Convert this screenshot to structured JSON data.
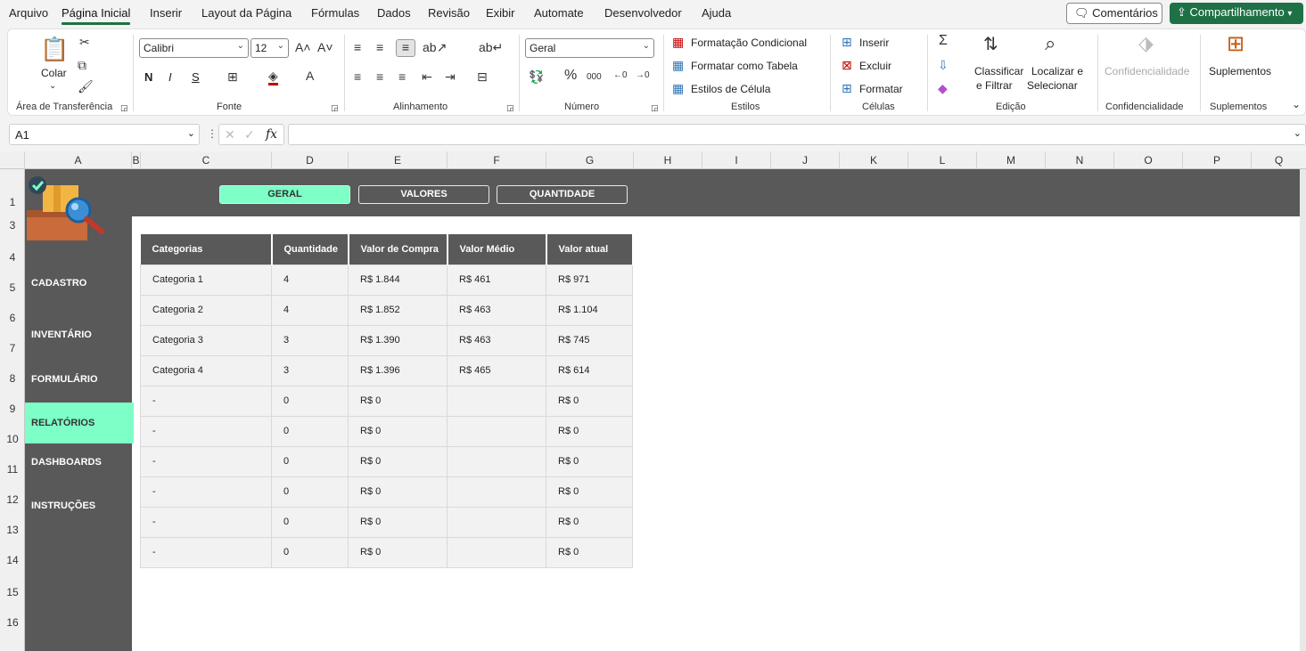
{
  "menu": {
    "items": [
      "Arquivo",
      "Página Inicial",
      "Inserir",
      "Layout da Página",
      "Fórmulas",
      "Dados",
      "Revisão",
      "Exibir",
      "Automate",
      "Desenvolvedor",
      "Ajuda"
    ],
    "comments": "Comentários",
    "share": "Compartilhamento"
  },
  "ribbon": {
    "clipboard": {
      "paste": "Colar",
      "label": "Área de Transferência"
    },
    "font": {
      "name": "Calibri",
      "size": "12",
      "bold": "N",
      "italic": "I",
      "underline": "S",
      "label": "Fonte"
    },
    "alignment": {
      "label": "Alinhamento"
    },
    "number": {
      "format": "Geral",
      "label": "Número"
    },
    "styles": {
      "conditional": "Formatação Condicional",
      "as_table": "Formatar como Tabela",
      "cell_styles": "Estilos de Célula",
      "label": "Estilos"
    },
    "cells": {
      "insert": "Inserir",
      "delete": "Excluir",
      "format": "Formatar",
      "label": "Células"
    },
    "editing": {
      "sort1": "Classificar",
      "sort2": "e Filtrar",
      "find1": "Localizar e",
      "find2": "Selecionar",
      "label": "Edição"
    },
    "sensitivity": {
      "button": "Confidencialidade",
      "label": "Confidencialidade"
    },
    "addins": {
      "button": "Suplementos",
      "label": "Suplementos"
    }
  },
  "formula_bar": {
    "name_box": "A1",
    "fx": "fx",
    "value": ""
  },
  "columns": [
    "A",
    "B",
    "C",
    "D",
    "E",
    "F",
    "G",
    "H",
    "I",
    "J",
    "K",
    "L",
    "M",
    "N",
    "O",
    "P",
    "Q"
  ],
  "rows": [
    "1",
    "3",
    "4",
    "5",
    "6",
    "7",
    "8",
    "9",
    "10",
    "11",
    "12",
    "13",
    "14",
    "15",
    "16"
  ],
  "dashboard": {
    "tabs": [
      {
        "label": "GERAL",
        "active": true
      },
      {
        "label": "VALORES",
        "active": false
      },
      {
        "label": "QUANTIDADE",
        "active": false
      }
    ],
    "nav": [
      {
        "label": "CADASTRO",
        "active": false
      },
      {
        "label": "INVENTÁRIO",
        "active": false
      },
      {
        "label": "FORMULÁRIO",
        "active": false
      },
      {
        "label": "RELATÓRIOS",
        "active": true
      },
      {
        "label": "DASHBOARDS",
        "active": false
      },
      {
        "label": "INSTRUÇÕES",
        "active": false
      }
    ],
    "accent_color": "#7dffc7",
    "panel_color": "#595959"
  },
  "table": {
    "headers": [
      "Categorias",
      "Quantidade",
      "Valor de Compra",
      "Valor Médio",
      "Valor atual"
    ],
    "rows": [
      [
        "Categoria 1",
        "4",
        "R$ 1.844",
        "R$ 461",
        "R$ 971"
      ],
      [
        "Categoria 2",
        "4",
        "R$ 1.852",
        "R$ 463",
        "R$ 1.104"
      ],
      [
        "Categoria 3",
        "3",
        "R$ 1.390",
        "R$ 463",
        "R$ 745"
      ],
      [
        "Categoria 4",
        "3",
        "R$ 1.396",
        "R$ 465",
        "R$ 614"
      ],
      [
        "-",
        "0",
        "R$ 0",
        "",
        "R$ 0"
      ],
      [
        "-",
        "0",
        "R$ 0",
        "",
        "R$ 0"
      ],
      [
        "-",
        "0",
        "R$ 0",
        "",
        "R$ 0"
      ],
      [
        "-",
        "0",
        "R$ 0",
        "",
        "R$ 0"
      ],
      [
        "-",
        "0",
        "R$ 0",
        "",
        "R$ 0"
      ],
      [
        "-",
        "0",
        "R$ 0",
        "",
        "R$ 0"
      ]
    ]
  }
}
